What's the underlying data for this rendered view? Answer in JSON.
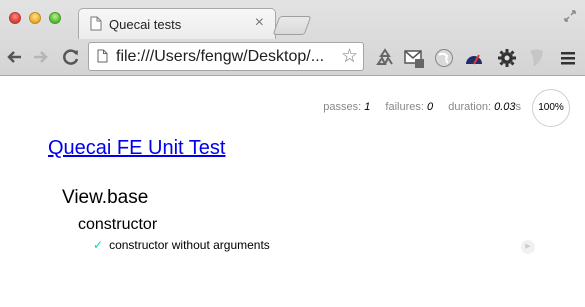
{
  "browser": {
    "tab_title": "Quecai tests",
    "tab_close": "×",
    "url": "file:///Users/fengw/Desktop/..."
  },
  "report": {
    "stats": {
      "passes_label": "passes:",
      "passes": "1",
      "failures_label": "failures:",
      "failures": "0",
      "duration_label": "duration:",
      "duration": "0.03",
      "duration_unit": "s"
    },
    "progress": "100%",
    "progress_value": 1.0,
    "title": "Quecai FE Unit Test",
    "suite": "View.base",
    "sub_suite": "constructor",
    "tests": [
      {
        "name": "constructor without arguments",
        "status": "passed",
        "mark": "✓"
      }
    ]
  },
  "icons": [
    "document-icon",
    "close-icon",
    "fullscreen-icon",
    "back-arrow-icon",
    "forward-arrow-icon",
    "reload-icon",
    "page-icon",
    "star-icon",
    "recycle-icon",
    "mail-icon",
    "globe-icon",
    "gauge-icon",
    "gear-icon",
    "shield-icon",
    "menu-icon",
    "replay-icon"
  ],
  "colors": {
    "link": "#0000ee",
    "check": "#00d6b2",
    "stat_label": "#888888"
  }
}
